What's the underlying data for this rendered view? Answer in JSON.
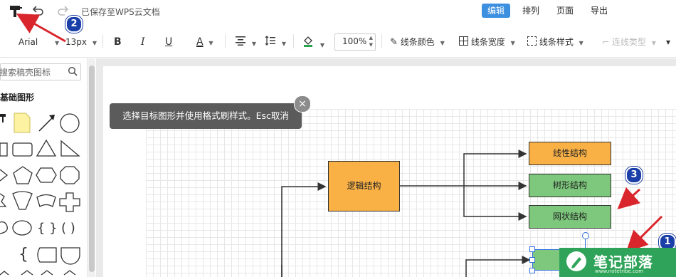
{
  "topbar": {
    "saved_status": "已保存至WPS云文档",
    "tabs": [
      {
        "label": "编辑",
        "active": true
      },
      {
        "label": "排列",
        "active": false
      },
      {
        "label": "页面",
        "active": false
      },
      {
        "label": "导出",
        "active": false
      }
    ]
  },
  "toolbar": {
    "font_family": "Arial",
    "font_size": "13px",
    "bold": "B",
    "italic": "I",
    "underline": "U",
    "font_color": "A",
    "zoom": "100%",
    "line_color": "线条颜色",
    "line_width": "线条宽度",
    "line_style": "线条样式",
    "connector_type": "连线类型"
  },
  "left_panel": {
    "search_placeholder": "搜索稿壳图标",
    "section_title": "基础图形"
  },
  "toast": {
    "message": "选择目标图形并使用格式刷样式。Esc取消",
    "close_symbol": "×"
  },
  "diagram": {
    "nodes": [
      {
        "id": "logic",
        "label": "逻辑结构"
      },
      {
        "id": "linear",
        "label": "线性结构"
      },
      {
        "id": "tree",
        "label": "树形结构"
      },
      {
        "id": "network",
        "label": "网状结构"
      }
    ]
  },
  "annotations": {
    "badges": [
      "1",
      "2",
      "3"
    ]
  },
  "watermark": {
    "text": "笔记部落",
    "subtext": "www.notetribe.com"
  },
  "colors": {
    "accent": "#3d8fe0",
    "node_orange": "#f9b146",
    "node_green": "#7dc87c",
    "arrow_red": "#d9262c",
    "badge_blue": "#1b3fa8"
  }
}
